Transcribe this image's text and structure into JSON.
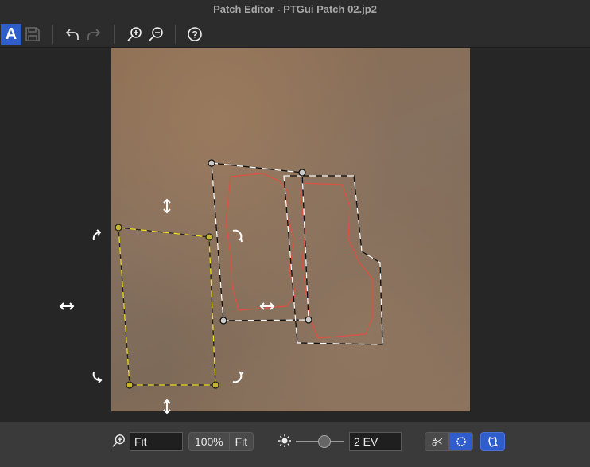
{
  "window": {
    "title": "Patch Editor - PTGui Patch 02.jp2"
  },
  "toolbar": {
    "auto_label": "A",
    "icons": [
      "save-icon",
      "undo-icon",
      "redo-icon",
      "zoom-in-icon",
      "zoom-out-icon",
      "help-icon"
    ]
  },
  "bottom": {
    "zoom_value": "Fit",
    "zoom_100_label": "100%",
    "zoom_fit_label": "Fit",
    "exposure_value": "2 EV",
    "exposure_slider_fraction": 0.5,
    "accent": "#2f5dcc"
  },
  "colors": {
    "selected_outline": "#f0e020",
    "patch_outline": "#ffffff",
    "mask_outline": "#e05040"
  }
}
